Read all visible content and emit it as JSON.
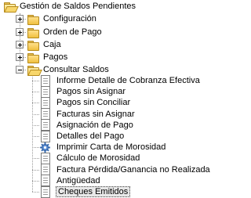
{
  "tree": {
    "root": {
      "label": "Gestión de Saldos Pendientes",
      "icon": "open-folder-icon",
      "expanded": true
    },
    "children": [
      {
        "label": "Configuración",
        "icon": "folder-icon",
        "expanded": false
      },
      {
        "label": "Orden de Pago",
        "icon": "folder-icon",
        "expanded": false
      },
      {
        "label": "Caja",
        "icon": "folder-icon",
        "expanded": false
      },
      {
        "label": "Pagos",
        "icon": "folder-icon",
        "expanded": false
      },
      {
        "label": "Consultar Saldos",
        "icon": "open-folder-icon",
        "expanded": true
      }
    ],
    "consultar_items": [
      {
        "label": "Informe Detalle de Cobranza Efectiva",
        "icon": "document-icon"
      },
      {
        "label": "Pagos sin Asignar",
        "icon": "document-icon"
      },
      {
        "label": "Pagos sin Conciliar",
        "icon": "document-icon"
      },
      {
        "label": "Facturas sin Asignar",
        "icon": "document-icon"
      },
      {
        "label": "Asignación de Pago",
        "icon": "document-icon"
      },
      {
        "label": "Detalles del Pago",
        "icon": "document-icon"
      },
      {
        "label": "Imprimir Carta de Morosidad",
        "icon": "gear-icon"
      },
      {
        "label": "Cálculo de Morosidad",
        "icon": "document-icon"
      },
      {
        "label": "Factura Pérdida/Ganancia no Realizada",
        "icon": "document-icon"
      },
      {
        "label": "Antigüedad",
        "icon": "document-icon"
      },
      {
        "label": "Cheques Emitidos",
        "icon": "document-icon",
        "selected": true
      }
    ]
  }
}
